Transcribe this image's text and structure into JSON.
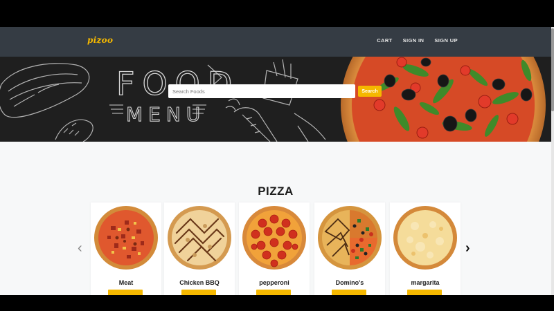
{
  "brand": {
    "logo": "pizoo"
  },
  "nav": {
    "links": [
      "CART",
      "SIGN IN",
      "SIGN UP"
    ]
  },
  "hero": {
    "banner_text": [
      "FOOD",
      "MENU"
    ],
    "search_placeholder": "Search Foods",
    "search_value": "",
    "search_button": "Search"
  },
  "section": {
    "title": "PIZZA"
  },
  "carousel": {
    "prev_icon": "‹",
    "next_icon": "›",
    "items": [
      {
        "name": "Meat",
        "button_label": ""
      },
      {
        "name": "Chicken BBQ",
        "button_label": ""
      },
      {
        "name": "pepperoni",
        "button_label": ""
      },
      {
        "name": "Domino's",
        "button_label": ""
      },
      {
        "name": "margarita",
        "button_label": ""
      }
    ]
  },
  "colors": {
    "accent": "#f5b800",
    "navbar": "#353c44",
    "hero_bg": "#1d1d1d",
    "page_bg": "#f7f8f9"
  }
}
